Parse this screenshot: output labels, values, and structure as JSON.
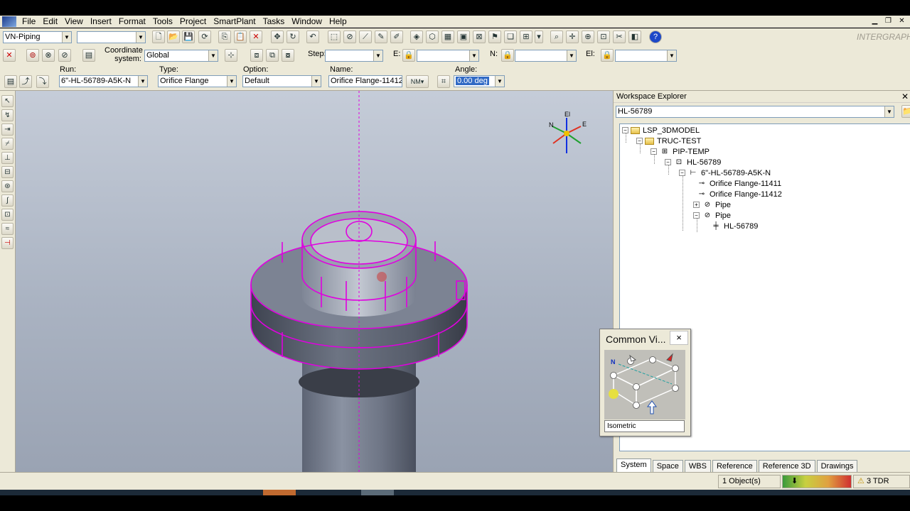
{
  "menu": {
    "items": [
      "File",
      "Edit",
      "View",
      "Insert",
      "Format",
      "Tools",
      "Project",
      "SmartPlant",
      "Tasks",
      "Window",
      "Help"
    ]
  },
  "toolbar1": {
    "task_select": "VN-Piping",
    "filter_select": "",
    "brand": "INTERGRAPH"
  },
  "toolbar2": {
    "coordinate_label": "Coordinate system:",
    "coordinate_value": "Global",
    "step_label": "Step:",
    "step_value": "",
    "e_label": "E:",
    "n_label": "N:",
    "el_label": "El:"
  },
  "toolbar3": {
    "run_label": "Run:",
    "run_value": "6\"-HL-56789-A5K-N",
    "type_label": "Type:",
    "type_value": "Orifice Flange",
    "option_label": "Option:",
    "option_value": "Default",
    "name_label": "Name:",
    "name_value": "Orifice Flange-11412",
    "angle_label": "Angle:",
    "angle_value": "0.00 deg"
  },
  "compass": {
    "up": "El",
    "north": "N",
    "east": "E"
  },
  "workspace_explorer": {
    "title": "Workspace Explorer",
    "filter_value": "HL-56789",
    "tree": [
      "LSP_3DMODEL",
      "TRUC-TEST",
      "PIP-TEMP",
      "HL-56789",
      "6\"-HL-56789-A5K-N",
      "Orifice Flange-11411",
      "Orifice Flange-11412",
      "Pipe",
      "Pipe",
      "HL-56789"
    ],
    "tabs": [
      "System",
      "Space",
      "WBS",
      "Reference",
      "Reference 3D",
      "Drawings"
    ],
    "active_tab": "System"
  },
  "common_views": {
    "title": "Common Vi...",
    "close": "×",
    "axis_label": "N",
    "view_value": "Isometric"
  },
  "status": {
    "selected": "1 Object(s)",
    "warning": "3 TDR"
  },
  "colors": {
    "highlight": "#e000e0",
    "viewport_bg": "#b4bcc9",
    "chrome": "#ece9d8"
  }
}
